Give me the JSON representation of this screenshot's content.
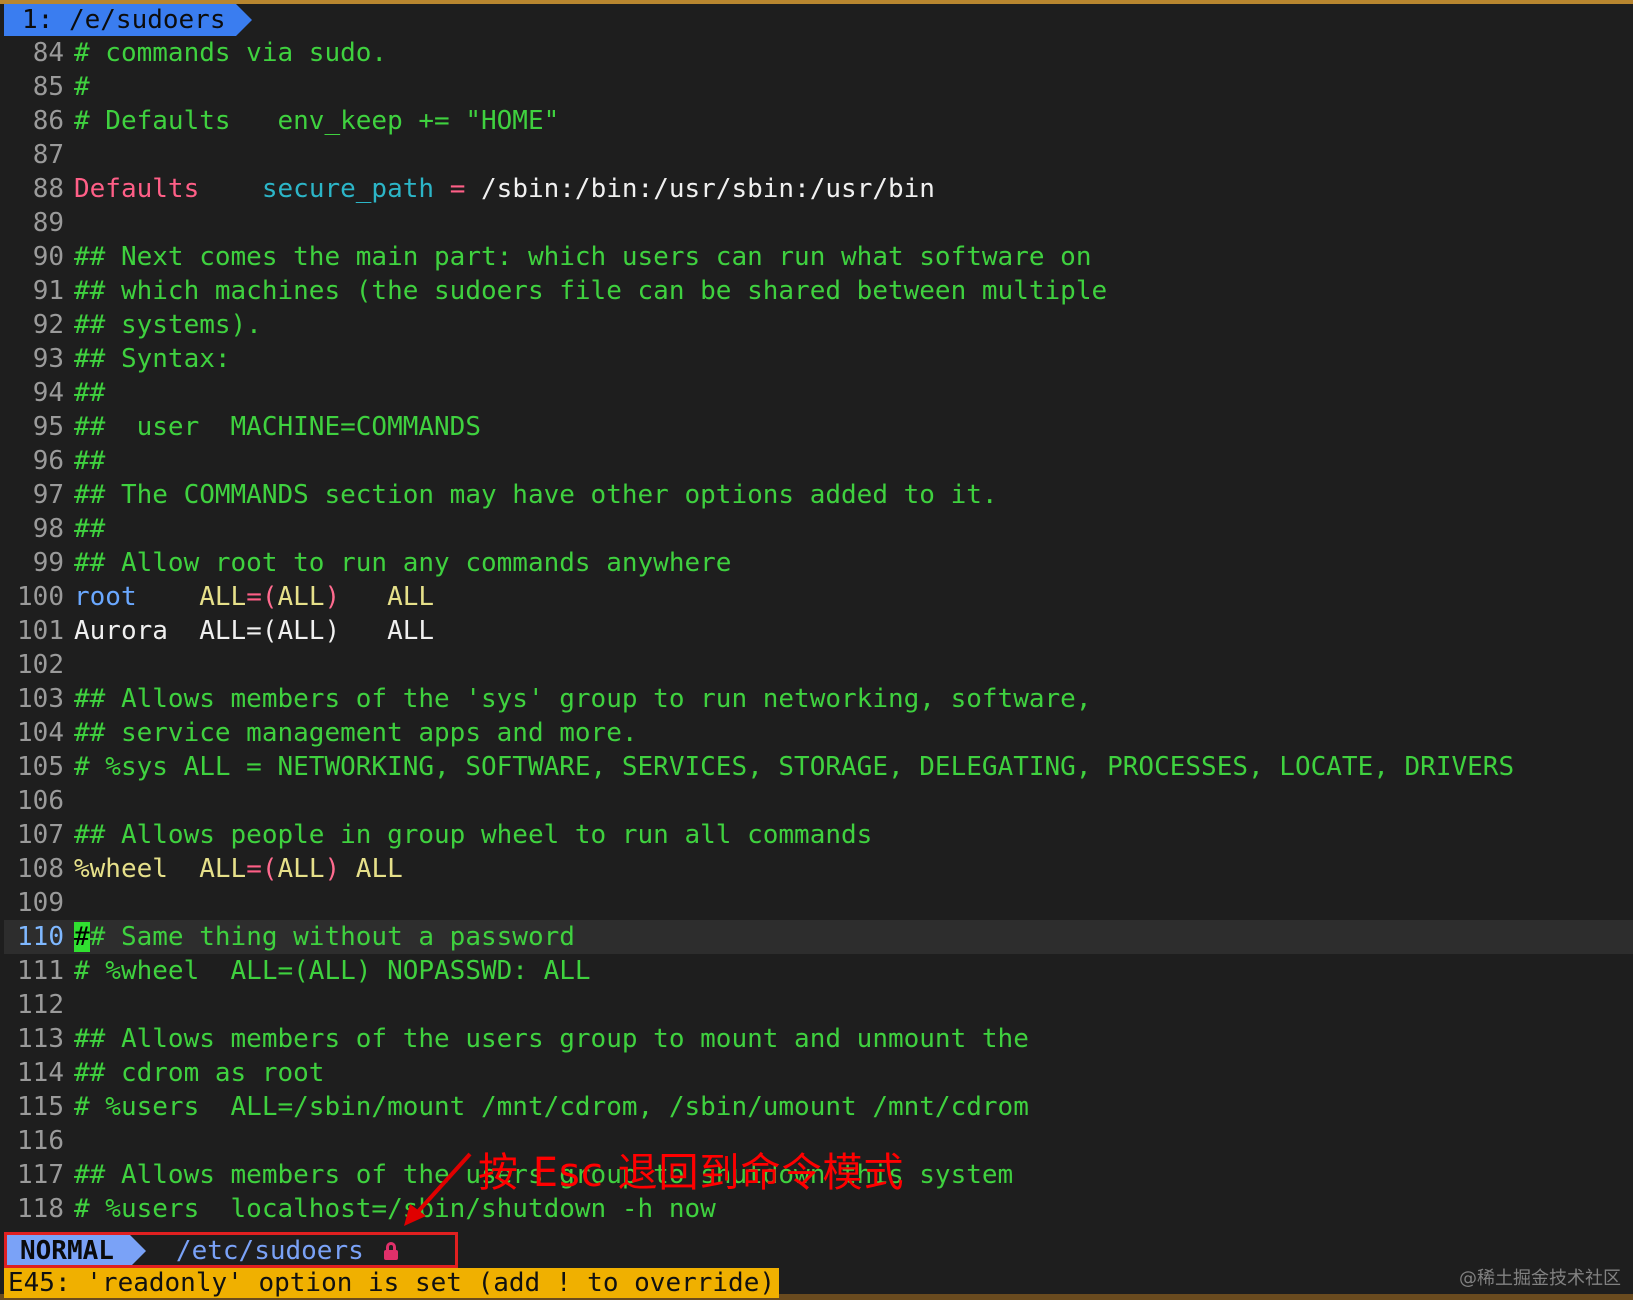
{
  "tabline": {
    "tab_label": "1: /e/sudoers"
  },
  "lines": [
    {
      "num": "84",
      "parts": [
        {
          "t": "# commands via sudo.",
          "c": "c-comment"
        }
      ]
    },
    {
      "num": "85",
      "parts": [
        {
          "t": "#",
          "c": "c-comment"
        }
      ]
    },
    {
      "num": "86",
      "parts": [
        {
          "t": "# Defaults   env_keep += \"HOME\"",
          "c": "c-comment"
        }
      ]
    },
    {
      "num": "87",
      "parts": []
    },
    {
      "num": "88",
      "parts": [
        {
          "t": "Defaults",
          "c": "c-kw"
        },
        {
          "t": "    ",
          "c": ""
        },
        {
          "t": "secure_path",
          "c": "c-ident"
        },
        {
          "t": " ",
          "c": ""
        },
        {
          "t": "=",
          "c": "c-op"
        },
        {
          "t": " /sbin:/bin:/usr/sbin:/usr/bin",
          "c": "c-white"
        }
      ]
    },
    {
      "num": "89",
      "parts": []
    },
    {
      "num": "90",
      "parts": [
        {
          "t": "## Next comes the main part: which users can run what software on",
          "c": "c-comment"
        }
      ]
    },
    {
      "num": "91",
      "parts": [
        {
          "t": "## which machines (the sudoers file can be shared between multiple",
          "c": "c-comment"
        }
      ]
    },
    {
      "num": "92",
      "parts": [
        {
          "t": "## systems).",
          "c": "c-comment"
        }
      ]
    },
    {
      "num": "93",
      "parts": [
        {
          "t": "## Syntax:",
          "c": "c-comment"
        }
      ]
    },
    {
      "num": "94",
      "parts": [
        {
          "t": "##",
          "c": "c-comment"
        }
      ]
    },
    {
      "num": "95",
      "parts": [
        {
          "t": "##  user  MACHINE=COMMANDS",
          "c": "c-comment"
        }
      ]
    },
    {
      "num": "96",
      "parts": [
        {
          "t": "##",
          "c": "c-comment"
        }
      ]
    },
    {
      "num": "97",
      "parts": [
        {
          "t": "## The COMMANDS section may have other options added to it.",
          "c": "c-comment"
        }
      ]
    },
    {
      "num": "98",
      "parts": [
        {
          "t": "##",
          "c": "c-comment"
        }
      ]
    },
    {
      "num": "99",
      "parts": [
        {
          "t": "## Allow root to run any commands anywhere",
          "c": "c-comment"
        }
      ]
    },
    {
      "num": "100",
      "parts": [
        {
          "t": "root",
          "c": "c-user"
        },
        {
          "t": "    ",
          "c": ""
        },
        {
          "t": "ALL",
          "c": "c-yellow"
        },
        {
          "t": "=",
          "c": "c-op"
        },
        {
          "t": "(",
          "c": "c-paren"
        },
        {
          "t": "ALL",
          "c": "c-yellow"
        },
        {
          "t": ")",
          "c": "c-paren"
        },
        {
          "t": "   ALL",
          "c": "c-yellow"
        }
      ]
    },
    {
      "num": "101",
      "parts": [
        {
          "t": "Aurora  ALL=(ALL)   ALL",
          "c": "c-white"
        }
      ]
    },
    {
      "num": "102",
      "parts": []
    },
    {
      "num": "103",
      "parts": [
        {
          "t": "## Allows members of the 'sys' group to run networking, software,",
          "c": "c-comment"
        }
      ]
    },
    {
      "num": "104",
      "parts": [
        {
          "t": "## service management apps and more.",
          "c": "c-comment"
        }
      ]
    },
    {
      "num": "105",
      "parts": [
        {
          "t": "# %sys ALL = NETWORKING, SOFTWARE, SERVICES, STORAGE, DELEGATING, PROCESSES, LOCATE, DRIVERS",
          "c": "c-comment"
        }
      ]
    },
    {
      "num": "106",
      "parts": []
    },
    {
      "num": "107",
      "parts": [
        {
          "t": "## Allows people in group wheel to run all commands",
          "c": "c-comment"
        }
      ]
    },
    {
      "num": "108",
      "parts": [
        {
          "t": "%wheel",
          "c": "c-yellow"
        },
        {
          "t": "  ",
          "c": ""
        },
        {
          "t": "ALL",
          "c": "c-yellow"
        },
        {
          "t": "=",
          "c": "c-op"
        },
        {
          "t": "(",
          "c": "c-paren"
        },
        {
          "t": "ALL",
          "c": "c-yellow"
        },
        {
          "t": ")",
          "c": "c-paren"
        },
        {
          "t": " ALL",
          "c": "c-yellow"
        }
      ]
    },
    {
      "num": "109",
      "parts": []
    },
    {
      "num": "110",
      "cur": true,
      "parts": [
        {
          "t": "#",
          "c": "cursor"
        },
        {
          "t": "# Same thing without a password",
          "c": "c-comment"
        }
      ]
    },
    {
      "num": "111",
      "parts": [
        {
          "t": "# %wheel  ALL=(ALL) NOPASSWD: ALL",
          "c": "c-comment"
        }
      ]
    },
    {
      "num": "112",
      "parts": []
    },
    {
      "num": "113",
      "parts": [
        {
          "t": "## Allows members of the users group to mount and unmount the",
          "c": "c-comment"
        }
      ]
    },
    {
      "num": "114",
      "parts": [
        {
          "t": "## cdrom as root",
          "c": "c-comment"
        }
      ]
    },
    {
      "num": "115",
      "parts": [
        {
          "t": "# %users  ALL=/sbin/mount /mnt/cdrom, /sbin/umount /mnt/cdrom",
          "c": "c-comment"
        }
      ]
    },
    {
      "num": "116",
      "parts": []
    },
    {
      "num": "117",
      "parts": [
        {
          "t": "## Allows members of the users group to shutdown this system",
          "c": "c-comment"
        }
      ]
    },
    {
      "num": "118",
      "parts": [
        {
          "t": "# %users  localhost=/sbin/shutdown -h now",
          "c": "c-comment"
        }
      ]
    }
  ],
  "statusline": {
    "mode": "NORMAL",
    "path": "/etc/sudoers",
    "lock_icon": "lock-icon"
  },
  "error_message": "E45: 'readonly' option is set (add ! to override)",
  "annotation": "按 Esc 退回到命令模式",
  "watermark": "@稀土掘金技术社区",
  "colors": {
    "comment": "#3fd13f",
    "keyword": "#ff5f87",
    "mode_bg": "#7aa2f7",
    "error_bg": "#f0b000",
    "annotation": "#ff0000"
  }
}
